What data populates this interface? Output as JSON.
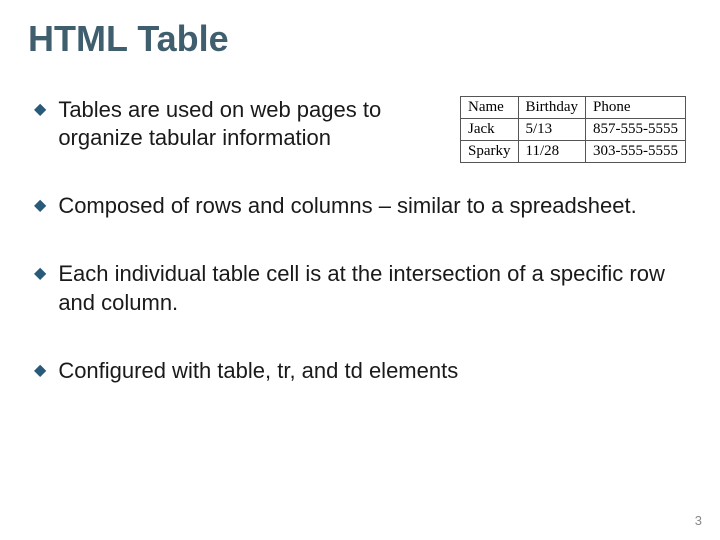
{
  "title": "HTML Table",
  "bullets": [
    "Tables are used on web pages to organize tabular information",
    "Composed of rows and columns – similar to a spreadsheet.",
    "Each individual table cell is at the intersection of a specific row and column.",
    "Configured with table, tr, and td elements"
  ],
  "table": {
    "headers": [
      "Name",
      "Birthday",
      "Phone"
    ],
    "rows": [
      [
        "Jack",
        "5/13",
        "857-555-5555"
      ],
      [
        "Sparky",
        "11/28",
        "303-555-5555"
      ]
    ]
  },
  "pageNumber": "3"
}
